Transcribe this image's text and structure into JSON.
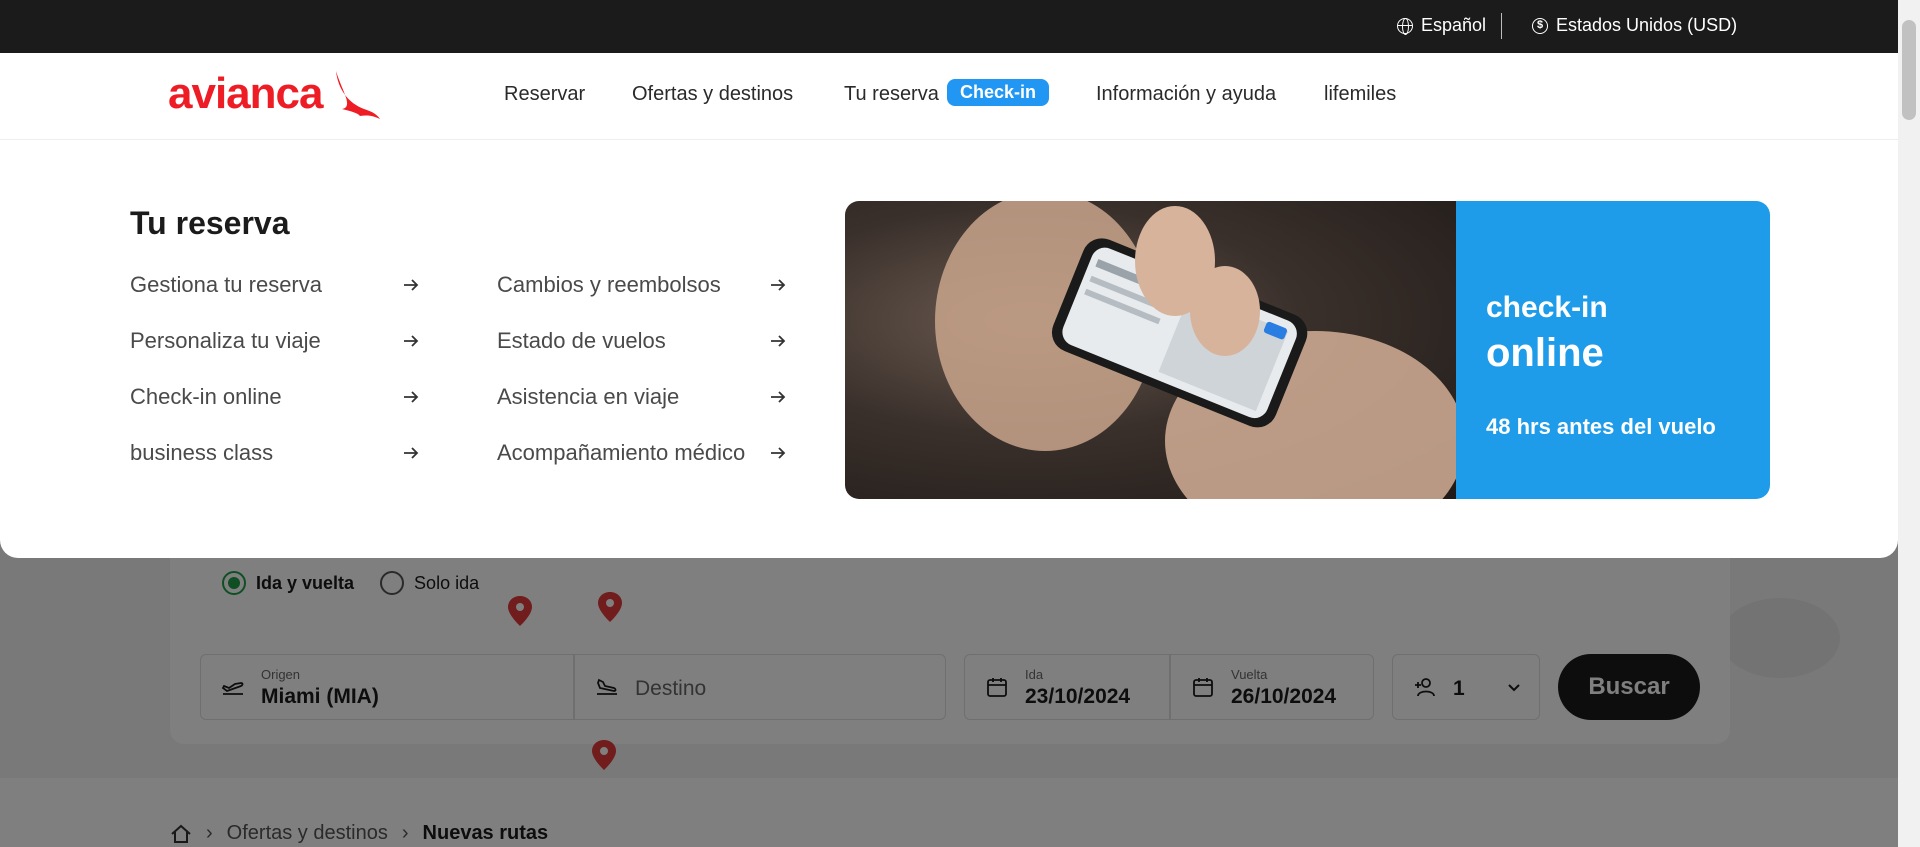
{
  "topbar": {
    "language": "Español",
    "currency": "Estados Unidos (USD)"
  },
  "nav": {
    "logo_text": "avianca",
    "links": [
      "Reservar",
      "Ofertas y destinos",
      "Tu reserva",
      "Información y ayuda",
      "lifemiles"
    ],
    "checkin_badge": "Check-in"
  },
  "mega_menu": {
    "title": "Tu reserva",
    "col1": [
      "Gestiona tu reserva",
      "Personaliza tu viaje",
      "Check-in online",
      "business class"
    ],
    "col2": [
      "Cambios y reembolsos",
      "Estado de vuelos",
      "Asistencia en viaje",
      "Acompañamiento médico"
    ],
    "promo": {
      "line1": "check-in",
      "line2": "online",
      "line3": "48 hrs antes del vuelo"
    }
  },
  "search": {
    "trip_round": "Ida y vuelta",
    "trip_oneway": "Solo ida",
    "origin_label": "Origen",
    "origin_value": "Miami (MIA)",
    "destination_placeholder": "Destino",
    "depart_label": "Ida",
    "depart_value": "23/10/2024",
    "return_label": "Vuelta",
    "return_value": "26/10/2024",
    "passengers": "1",
    "search_button": "Buscar"
  },
  "breadcrumb": {
    "parent": "Ofertas y destinos",
    "current": "Nuevas rutas"
  }
}
